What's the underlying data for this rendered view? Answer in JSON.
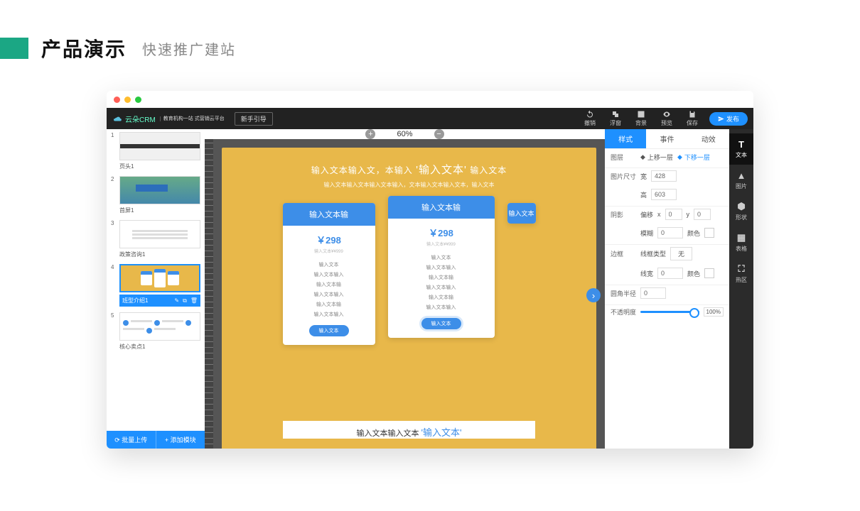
{
  "page": {
    "title": "产品演示",
    "subtitle": "快速推广建站"
  },
  "topbar": {
    "brand": "云朵CRM",
    "brand_sub": "教育机构一站\n式营销云平台",
    "guide": "新手引导",
    "icons": {
      "undo": "撤销",
      "float": "浮窗",
      "bg": "背景",
      "preview": "预览",
      "save": "保存"
    },
    "publish": "发布"
  },
  "sidebar": {
    "thumbs": [
      {
        "num": "1",
        "label": "页头1"
      },
      {
        "num": "2",
        "label": "首屏1"
      },
      {
        "num": "3",
        "label": "政策咨询1"
      },
      {
        "num": "4",
        "label": "班型介绍1",
        "active": true
      },
      {
        "num": "5",
        "label": "核心卖点1"
      }
    ],
    "batch": "批量上传",
    "add": "添加模块"
  },
  "zoom": {
    "level": "60%"
  },
  "canvas": {
    "heading_pre": "输入文本输入文，本输入",
    "heading_em": "'输入文本'",
    "heading_post": "输入文本",
    "sub": "输入文本输入文本输入文本输入，文本输入文本输入文本，输入文本",
    "card_title": "输入文本输",
    "price1": "￥298",
    "price2": "￥298",
    "note": "输入文本¥¥999",
    "feat": "输入文本",
    "feat2": "输入文本输入",
    "feat3": "输入文本输",
    "btn": "输入文本",
    "footer_pre": "输入文本输入文本",
    "footer_em": "'输入文本'"
  },
  "props": {
    "tabs": {
      "style": "样式",
      "event": "事件",
      "anim": "动效"
    },
    "layer": {
      "label": "图层",
      "up": "上移一层",
      "down": "下移一层"
    },
    "size": {
      "label": "图片尺寸",
      "w_label": "宽",
      "w": "428",
      "h_label": "高",
      "h": "603"
    },
    "shadow": {
      "label": "阴影",
      "offset": "偏移",
      "x": "x",
      "xv": "0",
      "y": "y",
      "yv": "0",
      "blur": "模糊",
      "bv": "0",
      "color": "颜色"
    },
    "border": {
      "label": "边框",
      "type_label": "线框类型",
      "type": "无",
      "width_label": "线宽",
      "width": "0",
      "color": "颜色"
    },
    "radius": {
      "label": "圆角半径",
      "val": "0"
    },
    "opacity": {
      "label": "不透明度",
      "val": "100%"
    }
  },
  "rail": {
    "text": "文本",
    "image": "图片",
    "shape": "形状",
    "table": "表格",
    "hotzone": "热区"
  }
}
